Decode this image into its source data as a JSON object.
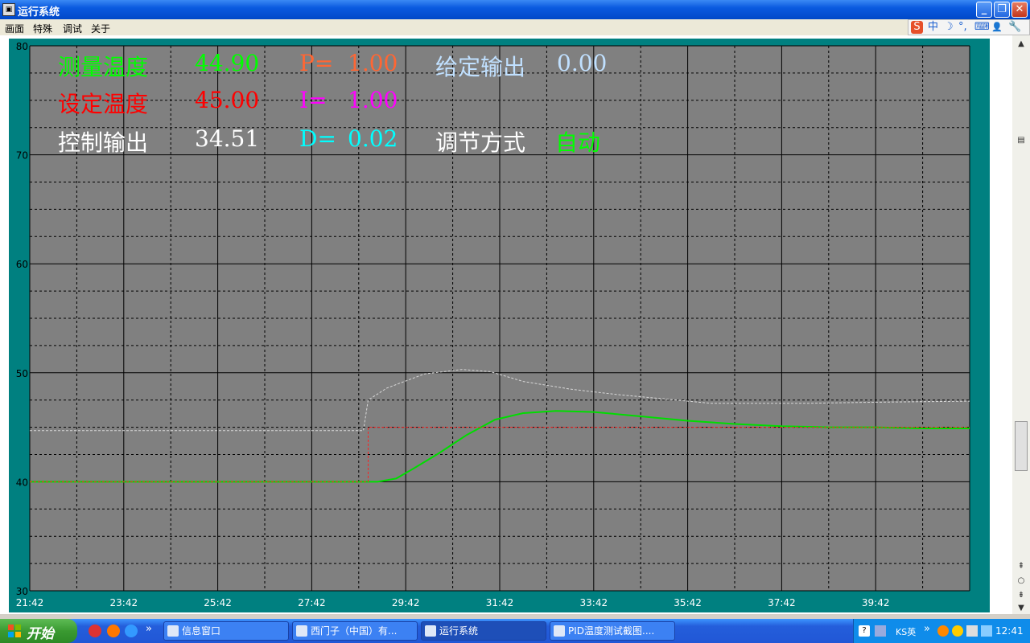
{
  "window": {
    "title": "运行系统",
    "buttons": {
      "minimize": "_",
      "maximize": "❐",
      "close": "✕"
    }
  },
  "menu": {
    "items": [
      "画面",
      "特殊",
      "调试",
      "关于"
    ]
  },
  "ime": {
    "icons": [
      "S",
      "中",
      "☽",
      "°,",
      "⌨",
      "👤",
      "🔧"
    ]
  },
  "readouts": {
    "measured_label": "测量温度",
    "measured_value": "44.90",
    "setpoint_label": "设定温度",
    "setpoint_value": "45.00",
    "control_label": "控制输出",
    "control_value": "34.51",
    "p_label": "P=",
    "p_value": "1.00",
    "i_label": "I=",
    "i_value": "1.00",
    "d_label": "D=",
    "d_value": "0.02",
    "given_label": "给定输出",
    "given_value": "0.00",
    "mode_label": "调节方式",
    "mode_value": "自动",
    "colors": {
      "measured": "#00ff00",
      "setpoint": "#ff0000",
      "control": "#ffffff",
      "p": "#ff6633",
      "i": "#ff00ff",
      "d": "#00ffff",
      "given": "#c0e0ff",
      "mode": "#00ff00"
    }
  },
  "chart_data": {
    "type": "line",
    "title": "",
    "xlabel": "",
    "ylabel": "",
    "ylim": [
      30,
      80
    ],
    "y_ticks": [
      "80",
      "70",
      "60",
      "50",
      "40",
      "30"
    ],
    "x_ticks": [
      "21:42",
      "23:42",
      "25:42",
      "27:42",
      "29:42",
      "31:42",
      "33:42",
      "35:42",
      "37:42",
      "39:42"
    ],
    "x_unit": "minutes from 21:42",
    "xlim": [
      0,
      20
    ],
    "grid": true,
    "background": "#808080",
    "series": [
      {
        "color": "#00dd00",
        "style": "solid",
        "x": [
          0,
          6,
          7.4,
          7.8,
          8.2,
          8.7,
          9.3,
          9.9,
          10.5,
          11.2,
          12,
          13,
          14,
          15,
          16,
          17,
          18,
          19,
          20
        ],
        "y": [
          40.0,
          40.0,
          40.0,
          40.3,
          41.3,
          42.6,
          44.3,
          45.7,
          46.3,
          46.5,
          46.4,
          46.0,
          45.6,
          45.3,
          45.1,
          45.0,
          45.0,
          44.9,
          44.9
        ]
      },
      {
        "color": "#ff2020",
        "style": "dashed",
        "x": [
          0,
          7.2,
          7.2,
          20
        ],
        "y": [
          40.0,
          40.0,
          45.0,
          45.0
        ]
      },
      {
        "color": "#d8d8d8",
        "style": "dashed",
        "x": [
          0,
          7.1,
          7.2,
          7.6,
          8.4,
          9.2,
          9.8,
          10.5,
          11.5,
          12.5,
          13.5,
          14.5,
          15.5,
          16.5,
          18,
          20
        ],
        "y": [
          44.7,
          44.7,
          47.5,
          48.6,
          49.9,
          50.3,
          50.1,
          49.2,
          48.5,
          48.0,
          47.6,
          47.2,
          47.2,
          47.2,
          47.3,
          47.4
        ]
      }
    ]
  },
  "taskbar": {
    "start_label": "开始",
    "tasks": [
      {
        "label": "信息窗口",
        "active": false
      },
      {
        "label": "西门子（中国）有...",
        "active": false
      },
      {
        "label": "运行系统",
        "active": true
      },
      {
        "label": "PID温度测试截图....",
        "active": false
      }
    ],
    "quicklaunch_more": "»",
    "tray_more": "»",
    "ks_label": "KS英",
    "clock": "12:41"
  }
}
